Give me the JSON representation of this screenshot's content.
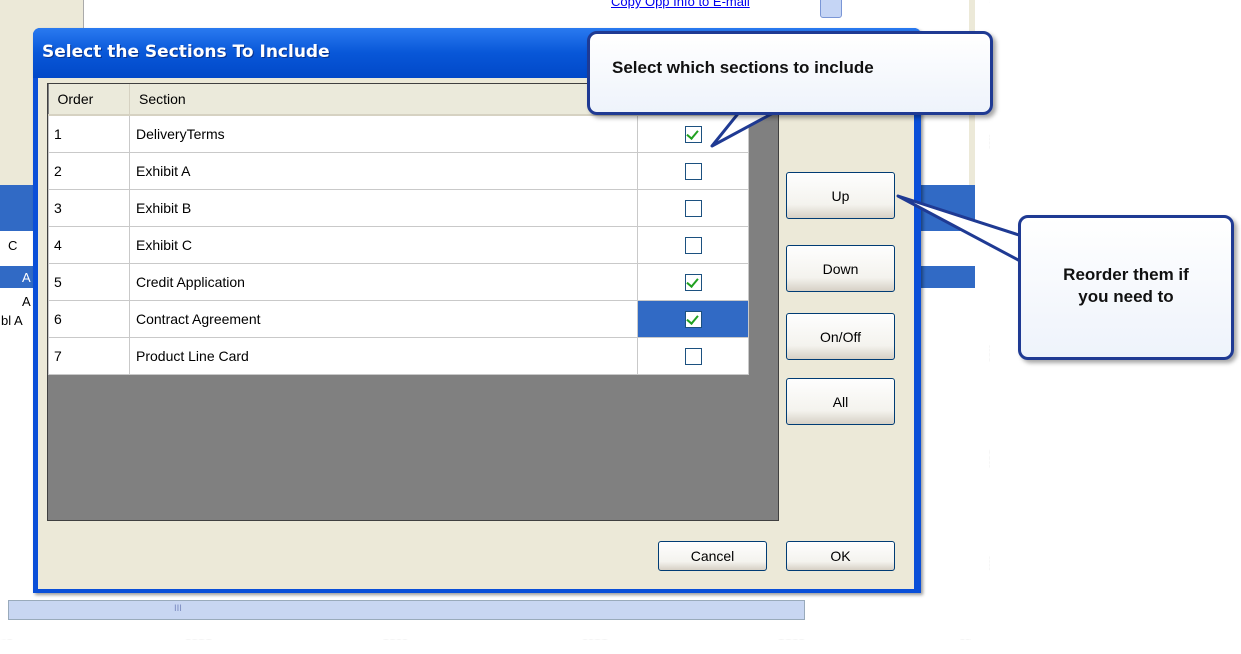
{
  "background_app": {
    "copy_link": "Copy Opp Info to E-mail",
    "fragments": [
      "C",
      "A",
      "A",
      "bl A"
    ],
    "scrollbar_grip": "III"
  },
  "dialog": {
    "title": "Select the Sections To Include",
    "columns": {
      "order": "Order",
      "section": "Section",
      "include": ""
    },
    "rows": [
      {
        "order": "1",
        "section": "DeliveryTerms",
        "checked": true,
        "selected": false
      },
      {
        "order": "2",
        "section": "Exhibit A",
        "checked": false,
        "selected": false
      },
      {
        "order": "3",
        "section": "Exhibit B",
        "checked": false,
        "selected": false
      },
      {
        "order": "4",
        "section": "Exhibit C",
        "checked": false,
        "selected": false
      },
      {
        "order": "5",
        "section": "Credit Application",
        "checked": true,
        "selected": false
      },
      {
        "order": "6",
        "section": "Contract Agreement",
        "checked": true,
        "selected": true
      },
      {
        "order": "7",
        "section": "Product Line Card",
        "checked": false,
        "selected": false
      }
    ],
    "buttons": {
      "up": "Up",
      "down": "Down",
      "onoff": "On/Off",
      "all": "All",
      "cancel": "Cancel",
      "ok": "OK"
    }
  },
  "callouts": {
    "top": "Select which sections to include",
    "right_line1": "Reorder them if",
    "right_line2": "you need to"
  },
  "colors": {
    "title_bar": "#0a4fd8",
    "selection": "#316ac5",
    "callout_border": "#1f3a93",
    "checkmark": "#21a121"
  }
}
